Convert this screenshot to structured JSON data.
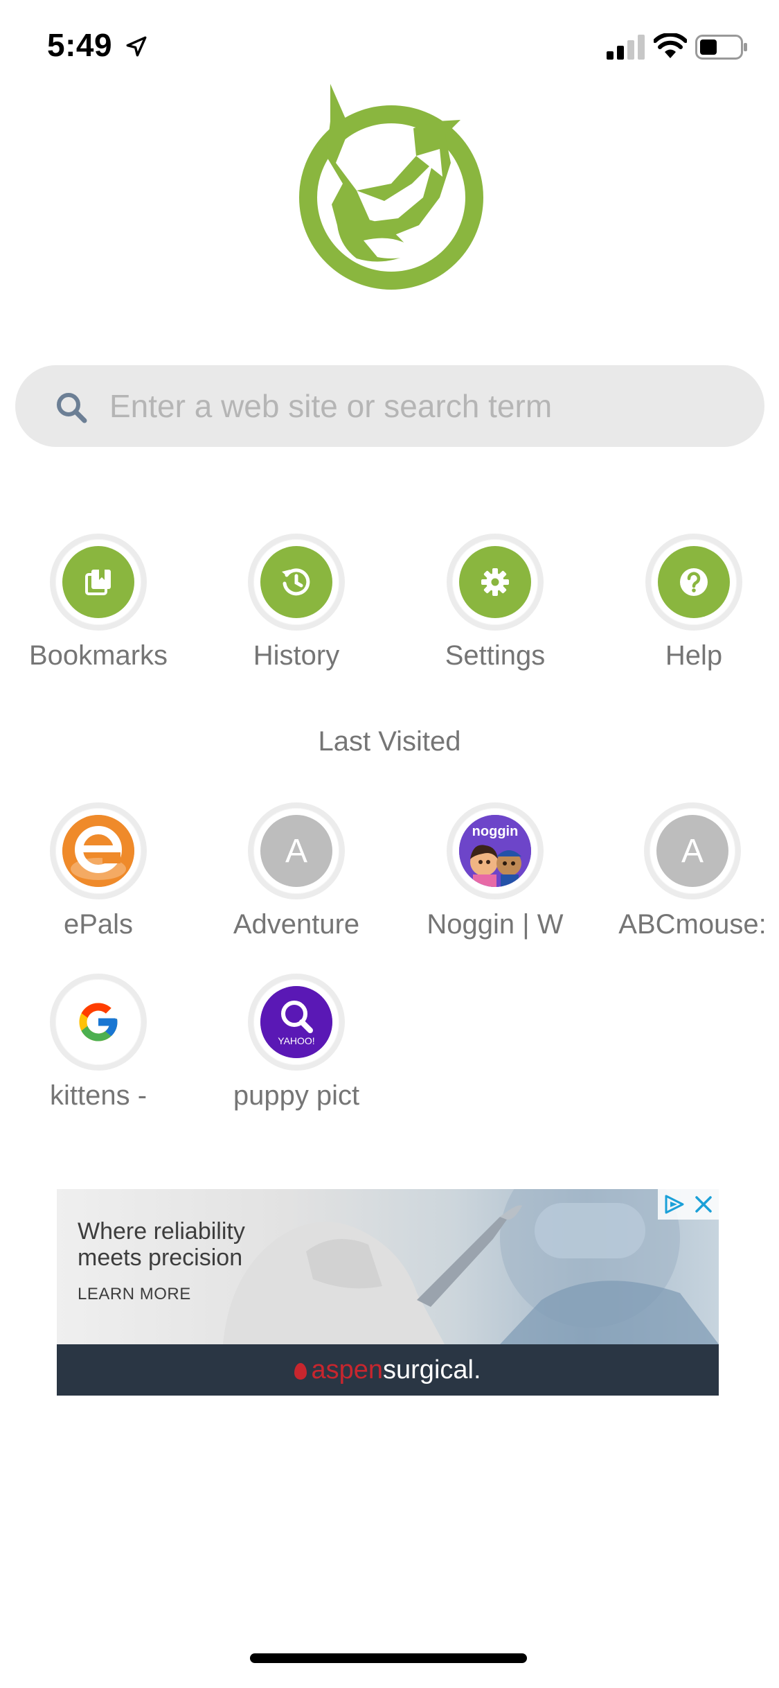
{
  "status_bar": {
    "time": "5:49",
    "icons": [
      "location-arrow-icon",
      "cellular-signal-icon",
      "wifi-icon",
      "battery-icon"
    ]
  },
  "logo": {
    "icon": "fox-logo-icon",
    "color": "#8ab63f"
  },
  "search": {
    "placeholder": "Enter a web site or search term",
    "value": "",
    "icon": "search-icon"
  },
  "quick_actions": [
    {
      "label": "Bookmarks",
      "icon": "bookmarks-icon"
    },
    {
      "label": "History",
      "icon": "history-icon"
    },
    {
      "label": "Settings",
      "icon": "gear-icon"
    },
    {
      "label": "Help",
      "icon": "help-icon"
    }
  ],
  "last_visited": {
    "title": "Last Visited",
    "items": [
      {
        "label": "ePals",
        "icon": "epals-favicon",
        "letter": "e"
      },
      {
        "label": "Adventure",
        "icon": "letter-favicon",
        "letter": "A"
      },
      {
        "label": "Noggin | W",
        "icon": "noggin-favicon",
        "letter": "noggin"
      },
      {
        "label": "ABCmouse:",
        "icon": "letter-favicon",
        "letter": "A"
      },
      {
        "label": "kittens -",
        "icon": "google-favicon",
        "letter": "G"
      },
      {
        "label": "puppy pict",
        "icon": "yahoo-favicon",
        "letter": "YAHOO!"
      }
    ]
  },
  "ad": {
    "headline": "Where reliability meets precision",
    "cta": "LEARN MORE",
    "brand_part1": "aspen",
    "brand_part2": "surgical.",
    "brand_color_1": "#c8262e",
    "icons": [
      "adchoices-icon",
      "close-icon"
    ]
  },
  "colors": {
    "accent": "#8ab63f",
    "search_bg": "#e9e9e9",
    "label": "#757575"
  }
}
